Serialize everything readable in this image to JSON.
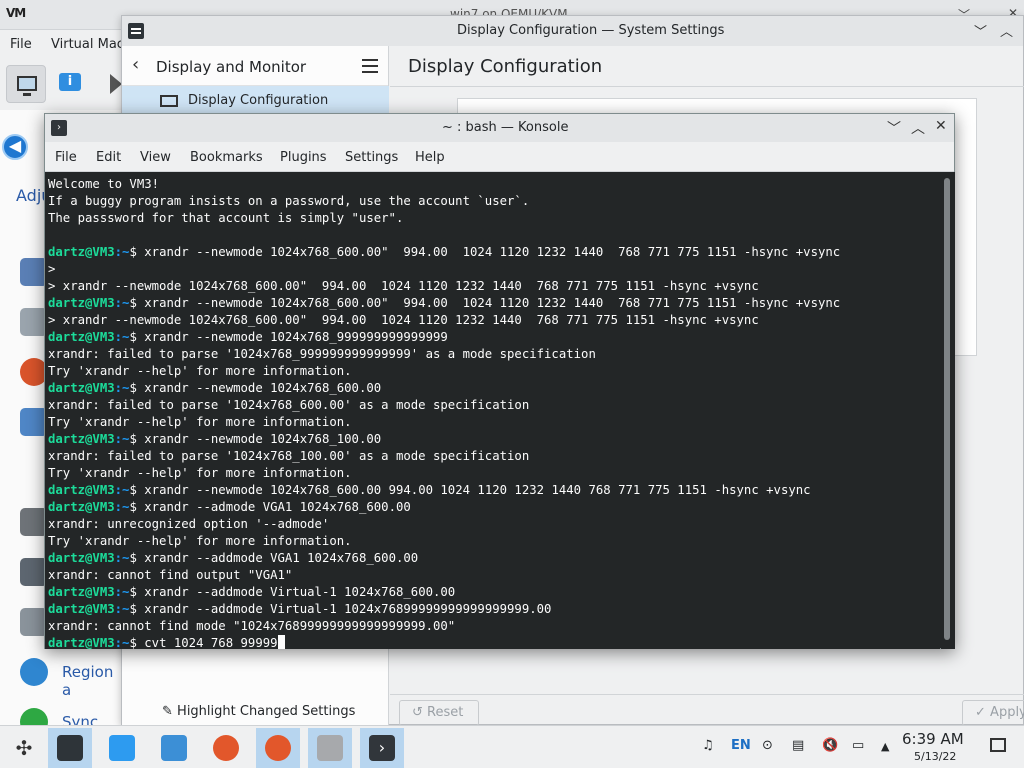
{
  "vm_window": {
    "title": "win7 on QEMU/KVM",
    "app_logo": "VM",
    "menu": [
      "File",
      "Virtual Mac"
    ]
  },
  "guest": {
    "adjust_text": "Adju",
    "region_text": "Region a",
    "sync_text": "Sync Cen"
  },
  "settings": {
    "title": "Display Configuration — System Settings",
    "sidebar_title": "Display and Monitor",
    "sidebar_selected": "Display Configuration",
    "main_title": "Display Configuration",
    "highlight_label": "Highlight Changed Settings",
    "reset_label": "Reset",
    "apply_label": "Apply"
  },
  "konsole": {
    "title": "~ : bash — Konsole",
    "menu": [
      "File",
      "Edit",
      "View",
      "Bookmarks",
      "Plugins",
      "Settings",
      "Help"
    ],
    "prompt_user": "dartz@VM3",
    "prompt_path": ":~",
    "prompt_sigil": "$ ",
    "lines": [
      {
        "t": "o",
        "text": "Welcome to VM3!"
      },
      {
        "t": "o",
        "text": "If a buggy program insists on a password, use the account `user`."
      },
      {
        "t": "o",
        "text": "The passsword for that account is simply \"user\"."
      },
      {
        "t": "o",
        "text": ""
      },
      {
        "t": "p",
        "text": "xrandr --newmode 1024x768_600.00\"  994.00  1024 1120 1232 1440  768 771 775 1151 -hsync +vsync"
      },
      {
        "t": "o",
        "text": ">"
      },
      {
        "t": "o",
        "text": "> xrandr --newmode 1024x768_600.00\"  994.00  1024 1120 1232 1440  768 771 775 1151 -hsync +vsync"
      },
      {
        "t": "p",
        "text": "xrandr --newmode 1024x768_600.00\"  994.00  1024 1120 1232 1440  768 771 775 1151 -hsync +vsync"
      },
      {
        "t": "o",
        "text": "> xrandr --newmode 1024x768_600.00\"  994.00  1024 1120 1232 1440  768 771 775 1151 -hsync +vsync"
      },
      {
        "t": "p",
        "text": "xrandr --newmode 1024x768_999999999999999"
      },
      {
        "t": "o",
        "text": "xrandr: failed to parse '1024x768_999999999999999' as a mode specification"
      },
      {
        "t": "o",
        "text": "Try 'xrandr --help' for more information."
      },
      {
        "t": "p",
        "text": "xrandr --newmode 1024x768_600.00"
      },
      {
        "t": "o",
        "text": "xrandr: failed to parse '1024x768_600.00' as a mode specification"
      },
      {
        "t": "o",
        "text": "Try 'xrandr --help' for more information."
      },
      {
        "t": "p",
        "text": "xrandr --newmode 1024x768_100.00"
      },
      {
        "t": "o",
        "text": "xrandr: failed to parse '1024x768_100.00' as a mode specification"
      },
      {
        "t": "o",
        "text": "Try 'xrandr --help' for more information."
      },
      {
        "t": "p",
        "text": "xrandr --newmode 1024x768_600.00 994.00 1024 1120 1232 1440 768 771 775 1151 -hsync +vsync"
      },
      {
        "t": "p",
        "text": "xrandr --admode VGA1 1024x768_600.00"
      },
      {
        "t": "o",
        "text": "xrandr: unrecognized option '--admode'"
      },
      {
        "t": "o",
        "text": "Try 'xrandr --help' for more information."
      },
      {
        "t": "p",
        "text": "xrandr --addmode VGA1 1024x768_600.00"
      },
      {
        "t": "o",
        "text": "xrandr: cannot find output \"VGA1\""
      },
      {
        "t": "p",
        "text": "xrandr --addmode Virtual-1 1024x768_600.00"
      },
      {
        "t": "p",
        "text": "xrandr --addmode Virtual-1 1024x76899999999999999999.00"
      },
      {
        "t": "o",
        "text": "xrandr: cannot find mode \"1024x76899999999999999999.00\""
      },
      {
        "t": "c",
        "text": "cvt 1024 768 99999"
      }
    ]
  },
  "taskbar": {
    "keyboard_layout": "EN",
    "time": "6:39 AM",
    "date": "5/13/22",
    "apps": [
      "application-launcher-icon",
      "system-settings-icon",
      "discover-icon",
      "dolphin-icon",
      "firefox-icon",
      "firefox-icon",
      "virt-manager-icon",
      "konsole-icon"
    ]
  }
}
